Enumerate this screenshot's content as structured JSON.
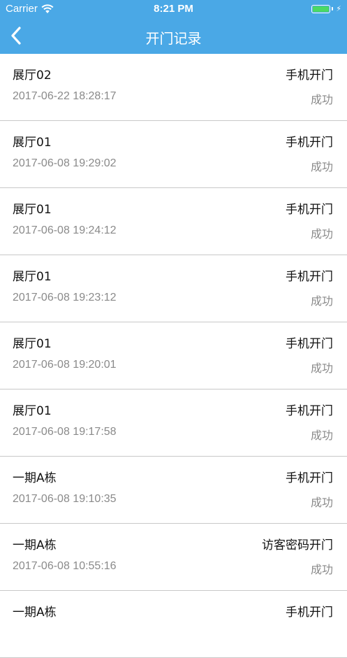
{
  "status_bar": {
    "carrier": "Carrier",
    "time": "8:21 PM",
    "battery_color": "#4cd964"
  },
  "nav": {
    "title": "开门记录",
    "back_icon": "chevron-left-icon",
    "background": "#4aa8e6"
  },
  "records": [
    {
      "name": "展厅02",
      "method": "手机开门",
      "time": "2017-06-22 18:28:17",
      "status": "成功"
    },
    {
      "name": "展厅01",
      "method": "手机开门",
      "time": "2017-06-08 19:29:02",
      "status": "成功"
    },
    {
      "name": "展厅01",
      "method": "手机开门",
      "time": "2017-06-08 19:24:12",
      "status": "成功"
    },
    {
      "name": "展厅01",
      "method": "手机开门",
      "time": "2017-06-08 19:23:12",
      "status": "成功"
    },
    {
      "name": "展厅01",
      "method": "手机开门",
      "time": "2017-06-08 19:20:01",
      "status": "成功"
    },
    {
      "name": "展厅01",
      "method": "手机开门",
      "time": "2017-06-08 19:17:58",
      "status": "成功"
    },
    {
      "name": "一期A栋",
      "method": "手机开门",
      "time": "2017-06-08 19:10:35",
      "status": "成功"
    },
    {
      "name": "一期A栋",
      "method": "访客密码开门",
      "time": "2017-06-08 10:55:16",
      "status": "成功"
    },
    {
      "name": "一期A栋",
      "method": "手机开门",
      "time": "",
      "status": ""
    }
  ]
}
